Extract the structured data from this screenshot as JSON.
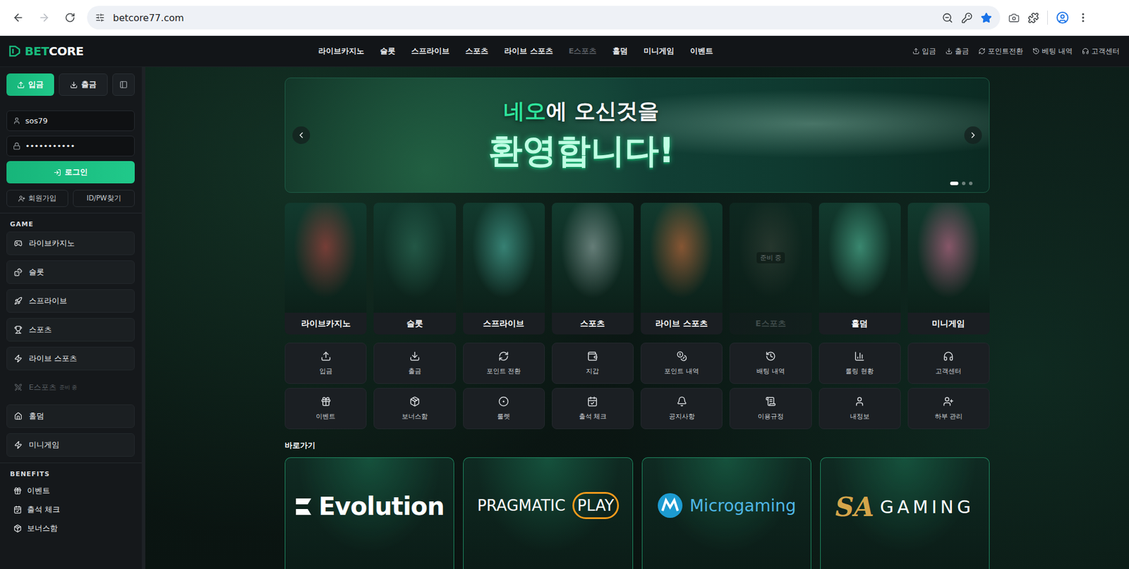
{
  "browser": {
    "url": "betcore77.com",
    "forward_enabled": false,
    "bookmarked": true
  },
  "header": {
    "logo": {
      "accent": "BET",
      "text": "CORE"
    },
    "nav": [
      {
        "label": "라이브카지노",
        "disabled": false
      },
      {
        "label": "슬롯",
        "disabled": false
      },
      {
        "label": "스프라이브",
        "disabled": false
      },
      {
        "label": "스포츠",
        "disabled": false
      },
      {
        "label": "라이브 스포츠",
        "disabled": false
      },
      {
        "label": "E스포츠",
        "disabled": true
      },
      {
        "label": "홀덤",
        "disabled": false
      },
      {
        "label": "미니게임",
        "disabled": false
      },
      {
        "label": "이벤트",
        "disabled": false
      }
    ],
    "links": [
      "입금",
      "출금",
      "포인트전환",
      "베팅 내역",
      "고객센터"
    ]
  },
  "sidebar": {
    "deposit": "입금",
    "withdraw": "출금",
    "username": "sos79",
    "password": "•••••••••••",
    "login": "로그인",
    "signup": "회원가입",
    "find": "ID/PW찾기",
    "game_title": "GAME",
    "games": [
      {
        "label": "라이브카지노",
        "disabled": false
      },
      {
        "label": "슬롯",
        "disabled": false
      },
      {
        "label": "스프라이브",
        "disabled": false
      },
      {
        "label": "스포츠",
        "disabled": false
      },
      {
        "label": "라이브 스포츠",
        "disabled": false
      },
      {
        "label": "E스포츠",
        "disabled": true,
        "badge": "준비 중"
      },
      {
        "label": "홀덤",
        "disabled": false
      },
      {
        "label": "미니게임",
        "disabled": false
      }
    ],
    "benefits_title": "BENEFITS",
    "benefits": [
      "이벤트",
      "출석 체크",
      "보너스함"
    ]
  },
  "banner": {
    "highlight": "네오",
    "line1": "에 오신것을",
    "line2": "환영합니다!",
    "slides": [
      {
        "selected": true
      },
      {
        "selected": false
      },
      {
        "selected": false
      }
    ]
  },
  "game_cards": [
    {
      "label": "라이브카지노",
      "disabled": false
    },
    {
      "label": "슬롯",
      "disabled": false
    },
    {
      "label": "스프라이브",
      "disabled": false
    },
    {
      "label": "스포츠",
      "disabled": false
    },
    {
      "label": "라이브 스포츠",
      "disabled": false
    },
    {
      "label": "E스포츠",
      "disabled": true,
      "badge": "준비 중"
    },
    {
      "label": "홀덤",
      "disabled": false
    },
    {
      "label": "미니게임",
      "disabled": false
    }
  ],
  "quick_actions": [
    "입금",
    "출금",
    "포인트 전환",
    "지갑",
    "포인트 내역",
    "배팅 내역",
    "롤링 현황",
    "고객센터",
    "이벤트",
    "보너스함",
    "룰렛",
    "출석 체크",
    "공지사항",
    "이용규정",
    "내정보",
    "하부 관리"
  ],
  "shortcuts_title": "바로가기",
  "providers": [
    {
      "kind": "evolution",
      "text": "Evolution"
    },
    {
      "kind": "pragmatic",
      "text": "PRAGMATIC",
      "accent": "PLAY"
    },
    {
      "kind": "microgaming",
      "text": "Microgaming"
    },
    {
      "kind": "sa",
      "accent": "SA",
      "text": "GAMING"
    }
  ]
}
